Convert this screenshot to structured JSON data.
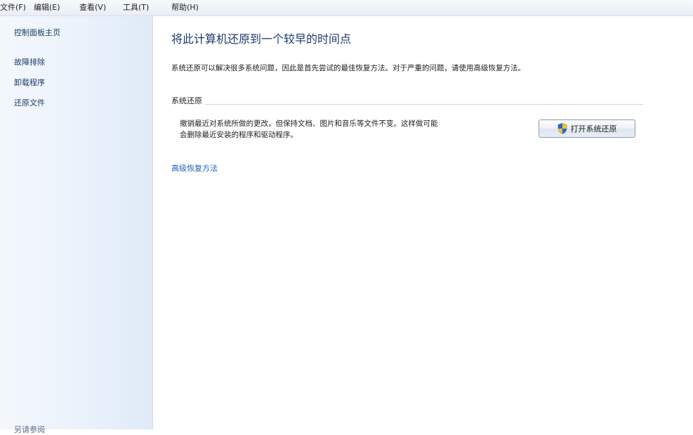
{
  "menubar": {
    "items": [
      {
        "label": "文件(F)"
      },
      {
        "label": "编辑(E)"
      },
      {
        "label": "查看(V)"
      },
      {
        "label": "工具(T)"
      },
      {
        "label": "帮助(H)"
      }
    ]
  },
  "sidebar": {
    "home": "控制面板主页",
    "links": [
      "故障排除",
      "卸载程序",
      "还原文件"
    ],
    "bottom": "另请参阅"
  },
  "main": {
    "title": "将此计算机还原到一个较早的时间点",
    "description": "系统还原可以解决很多系统问题，因此是首先尝试的最佳恢复方法。对于严重的问题，请使用高级恢复方法。",
    "section": {
      "title": "系统还原",
      "desc_line1": "撤销最近对系统所做的更改，但保持文档、图片和音乐等文件不变。这样做可能",
      "desc_line2": "会删除最近安装的程序和驱动程序。",
      "button_label": "打开系统还原",
      "button_icon": "uac-shield-icon"
    },
    "advanced_link": "高级恢复方法"
  }
}
